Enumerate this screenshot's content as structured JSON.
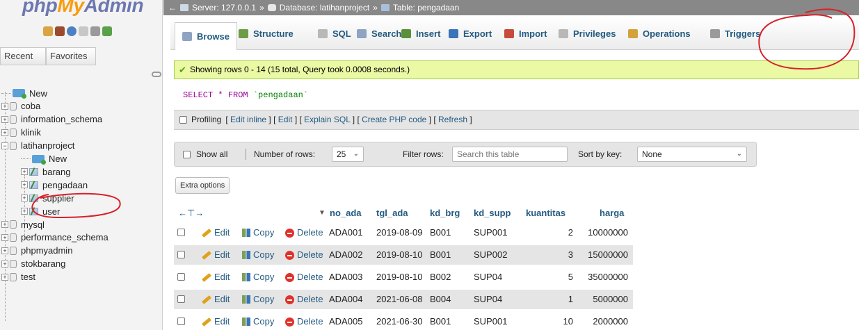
{
  "sidebar": {
    "logo": {
      "php": "php",
      "my": "My",
      "admin": "Admin"
    },
    "tabs": [
      {
        "label": "Recent"
      },
      {
        "label": "Favorites"
      }
    ],
    "tree": [
      {
        "label": "New",
        "kind": "new",
        "level": 0
      },
      {
        "label": "coba",
        "kind": "db",
        "level": 0
      },
      {
        "label": "information_schema",
        "kind": "db",
        "level": 0
      },
      {
        "label": "klinik",
        "kind": "db",
        "level": 0
      },
      {
        "label": "latihanproject",
        "kind": "db",
        "level": 0,
        "expanded": true
      },
      {
        "label": "New",
        "kind": "new",
        "level": 1
      },
      {
        "label": "barang",
        "kind": "table",
        "level": 1
      },
      {
        "label": "pengadaan",
        "kind": "table",
        "level": 1,
        "selected": true
      },
      {
        "label": "supplier",
        "kind": "table",
        "level": 1
      },
      {
        "label": "user",
        "kind": "table",
        "level": 1
      },
      {
        "label": "mysql",
        "kind": "db",
        "level": 0
      },
      {
        "label": "performance_schema",
        "kind": "db",
        "level": 0
      },
      {
        "label": "phpmyadmin",
        "kind": "db",
        "level": 0
      },
      {
        "label": "stokbarang",
        "kind": "db",
        "level": 0
      },
      {
        "label": "test",
        "kind": "db",
        "level": 0
      }
    ]
  },
  "breadcrumb": {
    "server": "Server: 127.0.0.1",
    "sep1": "»",
    "database": "Database: latihanproject",
    "sep2": "»",
    "table": "Table: pengadaan"
  },
  "tabs": [
    {
      "label": "Browse",
      "icon": "browse-icon",
      "active": true
    },
    {
      "label": "Structure",
      "icon": "structure-icon"
    },
    {
      "label": "SQL",
      "icon": "sql-icon"
    },
    {
      "label": "Search",
      "icon": "search-icon"
    },
    {
      "label": "Insert",
      "icon": "insert-icon"
    },
    {
      "label": "Export",
      "icon": "export-icon"
    },
    {
      "label": "Import",
      "icon": "import-icon"
    },
    {
      "label": "Privileges",
      "icon": "privileges-icon"
    },
    {
      "label": "Operations",
      "icon": "operations-icon"
    },
    {
      "label": "Triggers",
      "icon": "triggers-icon"
    }
  ],
  "message": "Showing rows 0 - 14 (15 total, Query took 0.0008 seconds.)",
  "sql": {
    "select": "SELECT",
    "star": "*",
    "from": "FROM",
    "table": "`pengadaan`"
  },
  "profiling": {
    "label": "Profiling",
    "open": "[",
    "edit_inline": "Edit inline",
    "edit": "Edit",
    "explain": "Explain SQL",
    "php": "Create PHP code",
    "refresh": "Refresh",
    "close": "]",
    "mid": "] ["
  },
  "navigation": {
    "show_all": "Show all",
    "num_rows_label": "Number of rows:",
    "num_rows": "25",
    "filter_label": "Filter rows:",
    "filter_placeholder": "Search this table",
    "sort_label": "Sort by key:",
    "sort_value": "None"
  },
  "extra_options": "Extra options",
  "table": {
    "columns": [
      "no_ada",
      "tgl_ada",
      "kd_brg",
      "kd_supp",
      "kuantitas",
      "harga"
    ],
    "actions": {
      "edit": "Edit",
      "copy": "Copy",
      "delete": "Delete"
    },
    "rows": [
      {
        "no_ada": "ADA001",
        "tgl_ada": "2019-08-09",
        "kd_brg": "B001",
        "kd_supp": "SUP001",
        "kuantitas": "2",
        "harga": "10000000"
      },
      {
        "no_ada": "ADA002",
        "tgl_ada": "2019-08-10",
        "kd_brg": "B001",
        "kd_supp": "SUP002",
        "kuantitas": "3",
        "harga": "15000000"
      },
      {
        "no_ada": "ADA003",
        "tgl_ada": "2019-08-10",
        "kd_brg": "B002",
        "kd_supp": "SUP04",
        "kuantitas": "5",
        "harga": "35000000"
      },
      {
        "no_ada": "ADA004",
        "tgl_ada": "2021-06-08",
        "kd_brg": "B004",
        "kd_supp": "SUP04",
        "kuantitas": "1",
        "harga": "5000000"
      },
      {
        "no_ada": "ADA005",
        "tgl_ada": "2021-06-30",
        "kd_brg": "B001",
        "kd_supp": "SUP001",
        "kuantitas": "10",
        "harga": "2000000"
      }
    ]
  },
  "colors": {
    "accent": "#235a81",
    "annotation": "#d8202a",
    "success_bg": "#ebf8a4"
  }
}
